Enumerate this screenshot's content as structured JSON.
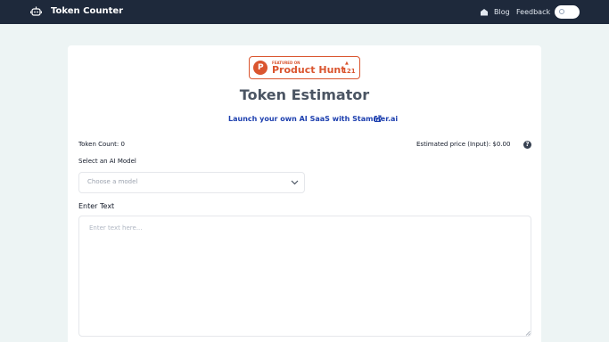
{
  "header": {
    "app_title": "Token Counter",
    "logo_icon": "robot-icon",
    "blog_icon": "blog-icon",
    "blog_label": "Blog",
    "feedback_label": "Feedback",
    "theme_toggle_on": false
  },
  "badge": {
    "logo_letter": "P",
    "featured_label": "FEATURED ON",
    "name": "Product Hunt",
    "upvotes": "121",
    "color": "#da552f"
  },
  "main": {
    "title": "Token Estimator",
    "promo_link": "Launch your own AI SaaS with Stammer.ai",
    "promo_icon": "external-link-icon",
    "token_count_label": "Token Count: 0",
    "price_label": "Estimated price (Input): $0.00",
    "help_icon_glyph": "?",
    "model_label": "Select an AI Model",
    "model_placeholder": "Choose a model",
    "text_label": "Enter Text",
    "text_placeholder": "Enter text here..."
  },
  "colors": {
    "nav_bg": "#1e293b",
    "page_bg": "#edf4f4",
    "link": "#1e40af"
  }
}
